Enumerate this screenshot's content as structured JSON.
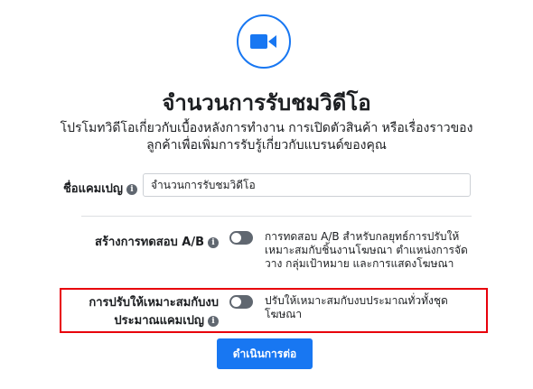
{
  "header": {
    "icon": "video-camera-icon",
    "title": "จำนวนการรับชมวิดีโอ",
    "subtitle": "โปรโมทวิดีโอเกี่ยวกับเบื้องหลังการทำงาน การเปิดตัวสินค้า หรือเรื่องราวของลูกค้าเพื่อเพิ่มการรับรู้เกี่ยวกับแบรนด์ของคุณ"
  },
  "form": {
    "campaign_name": {
      "label": "ชื่อแคมเปญ",
      "value": "จำนวนการรับชมวิดีโอ"
    },
    "ab_test": {
      "label": "สร้างการทดสอบ A/B",
      "toggle_on": false,
      "description": "การทดสอบ A/B สำหรับกลยุทธ์การปรับให้เหมาะสมกับชิ้นงานโฆษณา ตำแหน่งการจัดวาง กลุ่มเป้าหมาย และการแสดงโฆษณา"
    },
    "budget_optimization": {
      "label_line1": "การปรับให้เหมาะสมกับงบ",
      "label_line2": "ประมาณแคมเปญ",
      "toggle_on": false,
      "description": "ปรับให้เหมาะสมกับงบประมาณทั่วทั้งชุดโฆษณา"
    }
  },
  "actions": {
    "continue_label": "ดำเนินการต่อ"
  },
  "colors": {
    "accent": "#1877f2",
    "highlight": "#e8000b",
    "toggle_off": "#606770"
  }
}
